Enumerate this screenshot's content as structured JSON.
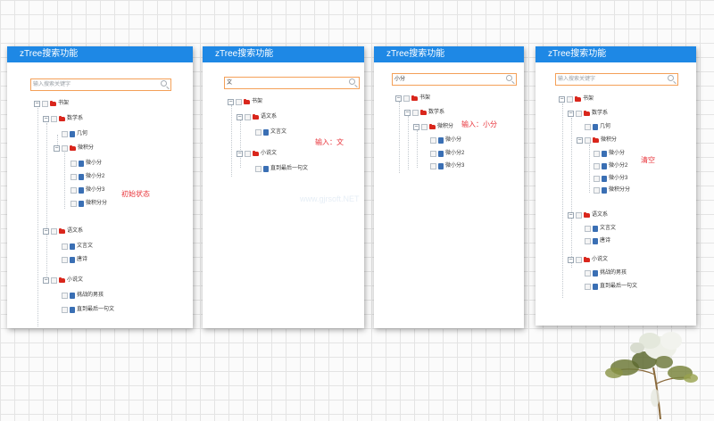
{
  "header_title": "zTree搜索功能",
  "search_placeholder": "输入搜索关键字",
  "panels": [
    {
      "search_value": "",
      "note": "初始状态",
      "tree": {
        "root": "书架",
        "l1a": "数学系",
        "l2a": "几何",
        "l2b": "微积分",
        "l3a": "微小分",
        "l3b": "微小分2",
        "l3c": "微小分3",
        "l3d": "微积分分",
        "l1b": "语文系",
        "l2c": "文言文",
        "l2d": "唐诗",
        "l1c": "小说文",
        "l2e": "挑战的男孩",
        "l2f": "直到最后一句文"
      }
    },
    {
      "search_value": "文",
      "note": "输入：文",
      "tree": {
        "root": "书架",
        "l1a": "语文系",
        "l2a": "文言文",
        "l1b": "小说文",
        "l2b": "直到最后一句文"
      }
    },
    {
      "search_value": "小分",
      "note": "输入：小分",
      "tree": {
        "root": "书架",
        "l1a": "数学系",
        "l2a": "微积分",
        "l3a": "微小分",
        "l3b": "微小分2",
        "l3c": "微小分3"
      }
    },
    {
      "search_value": "",
      "note": "清空",
      "tree": {
        "root": "书架",
        "l1a": "数学系",
        "l2a": "几何",
        "l2b": "微积分",
        "l3a": "微小分",
        "l3b": "微小分2",
        "l3c": "微小分3",
        "l3d": "微积分分",
        "l1b": "语文系",
        "l2c": "文言文",
        "l2d": "唐诗",
        "l1c": "小说文",
        "l2e": "挑战的男孩",
        "l2f": "直到最后一句文"
      }
    }
  ],
  "watermark": "www.gjrsoft.NET",
  "colors": {
    "header": "#1e88e5",
    "search_border": "#f4a058",
    "note": "#e8333a",
    "folder": "#d9261c",
    "file": "#3a6fb4"
  }
}
